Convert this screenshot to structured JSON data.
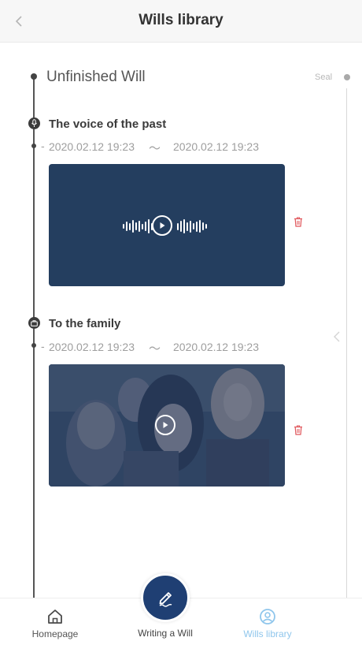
{
  "header": {
    "title": "Wills library",
    "back_icon": "chevron-left-icon"
  },
  "section": {
    "title": "Unfinished Will",
    "seal_label": "Seal"
  },
  "entries": [
    {
      "title": "The voice of the past",
      "icon": "microphone-icon",
      "date_start": "2020.02.12 19:23",
      "separator": "～",
      "date_end": "2020.02.12 19:23",
      "media": "audio",
      "delete_icon": "trash-icon"
    },
    {
      "title": "To the family",
      "icon": "briefcase-icon",
      "date_start": "2020.02.12 19:23",
      "separator": "～",
      "date_end": "2020.02.12 19:23",
      "media": "video",
      "delete_icon": "trash-icon"
    }
  ],
  "date_prefix": "-",
  "tabbar": {
    "home_label": "Homepage",
    "write_label": "Writing a Will",
    "library_label": "Wills library",
    "active_tab": "library"
  },
  "colors": {
    "accent": "#8fc6ec",
    "primary_button": "#1f3f73",
    "audio_card": "#243e5f",
    "delete": "#e0555a"
  }
}
